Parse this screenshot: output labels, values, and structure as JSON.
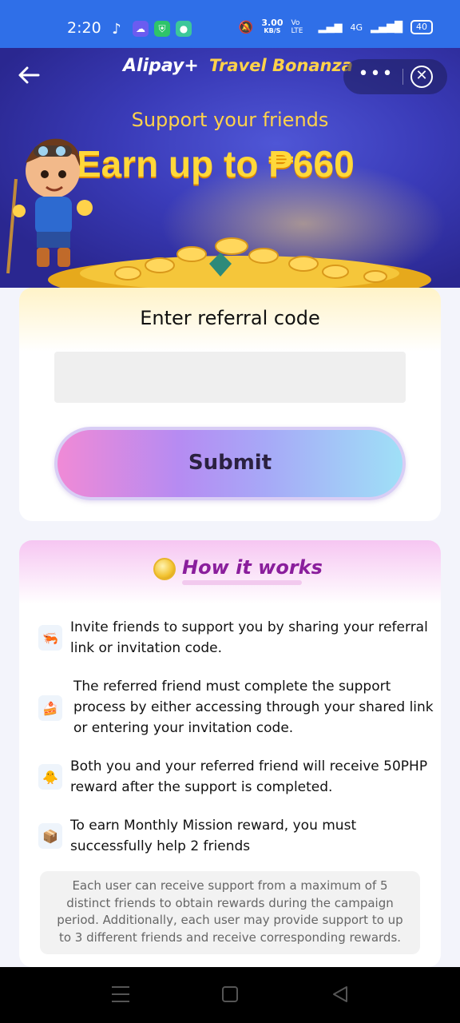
{
  "status_bar": {
    "time": "2:20",
    "speed_value": "3.00",
    "speed_unit": "KB/S",
    "network": "4G",
    "lte": "Vo LTE",
    "battery": "40"
  },
  "header": {
    "brand": "Alipay+",
    "campaign": "Travel Bonanza",
    "more_icon": "more-dots-icon",
    "close_icon": "close-circle-icon"
  },
  "hero": {
    "subtitle": "Support your friends",
    "title": "Earn up to ₱660"
  },
  "referral": {
    "title": "Enter referral code",
    "input_value": "",
    "submit_label": "Submit"
  },
  "how": {
    "title": "How it works",
    "steps": [
      {
        "icon": "invite-icon",
        "text": "Invite friends to support you by sharing your referral link or invitation code."
      },
      {
        "icon": "support-icon",
        "text": "The referred friend must complete the support process by either accessing through your shared link or entering your invitation code."
      },
      {
        "icon": "reward-icon",
        "text": "Both you and your referred friend will receive 50PHP reward after the support is completed."
      },
      {
        "icon": "mission-icon",
        "text": "To earn Monthly Mission reward, you must successfully help 2 friends"
      }
    ],
    "note": "Each user can receive support from a maximum of 5 distinct friends to obtain rewards during the campaign period. Additionally, each user may provide support to up to 3 different friends and receive corresponding rewards."
  },
  "colors": {
    "status_bar": "#2f6fe8",
    "hero_bg": "#3a3bb8",
    "hero_title": "#ffd83a",
    "how_title": "#8a1e9c"
  }
}
